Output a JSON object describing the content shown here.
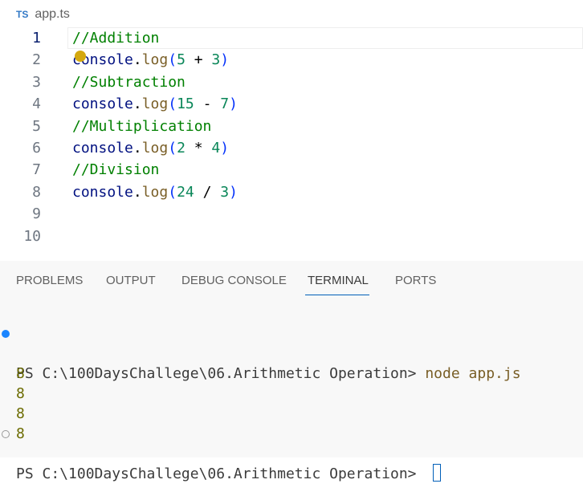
{
  "tab": {
    "icon_text": "TS",
    "filename": "app.ts"
  },
  "editor": {
    "lines": [
      {
        "num": "1",
        "tokens": [
          {
            "t": "//Addition",
            "c": "cm"
          }
        ]
      },
      {
        "num": "2",
        "tokens": [
          {
            "t": "console",
            "c": "obj"
          },
          {
            "t": ".",
            "c": "op"
          },
          {
            "t": "log",
            "c": "fn"
          },
          {
            "t": "(",
            "c": "paren"
          },
          {
            "t": "5",
            "c": "num"
          },
          {
            "t": " + ",
            "c": "op"
          },
          {
            "t": "3",
            "c": "num"
          },
          {
            "t": ")",
            "c": "paren"
          }
        ]
      },
      {
        "num": "3",
        "tokens": [
          {
            "t": "//Subtraction",
            "c": "cm"
          }
        ]
      },
      {
        "num": "4",
        "tokens": [
          {
            "t": "console",
            "c": "obj"
          },
          {
            "t": ".",
            "c": "op"
          },
          {
            "t": "log",
            "c": "fn"
          },
          {
            "t": "(",
            "c": "paren"
          },
          {
            "t": "15",
            "c": "num"
          },
          {
            "t": " - ",
            "c": "op"
          },
          {
            "t": "7",
            "c": "num"
          },
          {
            "t": ")",
            "c": "paren"
          }
        ]
      },
      {
        "num": "5",
        "tokens": [
          {
            "t": "//Multiplication",
            "c": "cm"
          }
        ]
      },
      {
        "num": "6",
        "tokens": [
          {
            "t": "console",
            "c": "obj"
          },
          {
            "t": ".",
            "c": "op"
          },
          {
            "t": "log",
            "c": "fn"
          },
          {
            "t": "(",
            "c": "paren"
          },
          {
            "t": "2",
            "c": "num"
          },
          {
            "t": " * ",
            "c": "op"
          },
          {
            "t": "4",
            "c": "num"
          },
          {
            "t": ")",
            "c": "paren"
          }
        ]
      },
      {
        "num": "7",
        "tokens": [
          {
            "t": "//Division",
            "c": "cm"
          }
        ]
      },
      {
        "num": "8",
        "tokens": [
          {
            "t": "console",
            "c": "obj"
          },
          {
            "t": ".",
            "c": "op"
          },
          {
            "t": "log",
            "c": "fn"
          },
          {
            "t": "(",
            "c": "paren"
          },
          {
            "t": "24",
            "c": "num"
          },
          {
            "t": " / ",
            "c": "op"
          },
          {
            "t": "3",
            "c": "num"
          },
          {
            "t": ")",
            "c": "paren"
          }
        ]
      },
      {
        "num": "9",
        "tokens": []
      },
      {
        "num": "10",
        "tokens": []
      }
    ],
    "lightbulb_icon": "lightbulb-icon"
  },
  "panel": {
    "tabs": [
      {
        "label": "PROBLEMS"
      },
      {
        "label": "OUTPUT"
      },
      {
        "label": "DEBUG CONSOLE"
      },
      {
        "label": "TERMINAL"
      },
      {
        "label": "PORTS"
      }
    ],
    "active_tab": "TERMINAL"
  },
  "terminal": {
    "prompt1": "PS C:\\100DaysChallege\\06.Arithmetic Operation> ",
    "command1": "node app.js",
    "outputs": [
      "8",
      "8",
      "8",
      "8"
    ],
    "prompt2": "PS C:\\100DaysChallege\\06.Arithmetic Operation> "
  },
  "colors": {
    "accent": "#005fb8",
    "ts_icon": "#3178c6",
    "comment": "#008000",
    "number": "#098658",
    "function": "#795e26"
  }
}
